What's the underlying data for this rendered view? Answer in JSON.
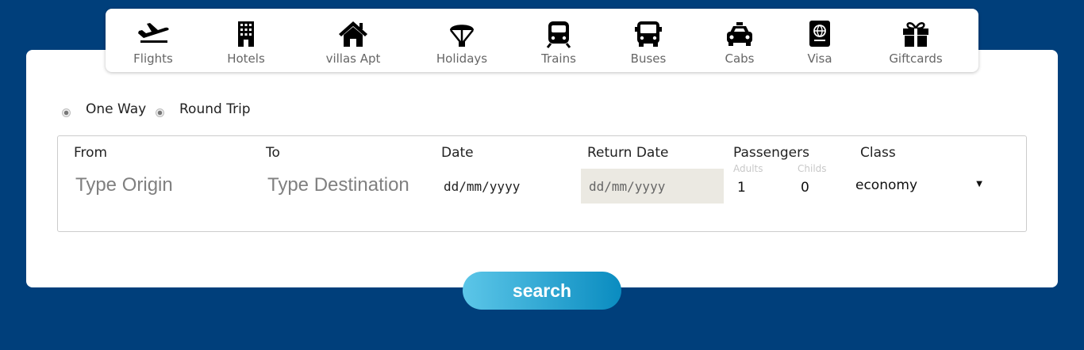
{
  "nav": {
    "items": [
      {
        "label": "Flights",
        "icon": "airplane-icon"
      },
      {
        "label": "Hotels",
        "icon": "hotel-building-icon"
      },
      {
        "label": "villas Apt",
        "icon": "house-icon"
      },
      {
        "label": "Holidays",
        "icon": "parachute-icon"
      },
      {
        "label": "Trains",
        "icon": "train-icon"
      },
      {
        "label": "Buses",
        "icon": "bus-icon"
      },
      {
        "label": "Cabs",
        "icon": "taxi-icon"
      },
      {
        "label": "Visa",
        "icon": "passport-icon"
      },
      {
        "label": "Giftcards",
        "icon": "gift-icon"
      }
    ]
  },
  "trip_type": {
    "one_way": "One Way",
    "round_trip": "Round Trip"
  },
  "form": {
    "from_label": "From",
    "from_placeholder": "Type Origin",
    "to_label": "To",
    "to_placeholder": "Type Destination",
    "date_label": "Date",
    "date_placeholder": "dd/mm/yyyy",
    "return_date_label": "Return Date",
    "return_date_placeholder": "dd/mm/yyyy",
    "passengers_label": "Passengers",
    "adults_label": "Adults",
    "adults_value": "1",
    "childs_label": "Childs",
    "childs_value": "0",
    "class_label": "Class",
    "class_value": "economy"
  },
  "search_label": "search",
  "colors": {
    "page_background": "#003f7b",
    "button_gradient_start": "#5cc6e8",
    "button_gradient_end": "#0a8cc0",
    "return_date_background": "#ebe9e2"
  }
}
